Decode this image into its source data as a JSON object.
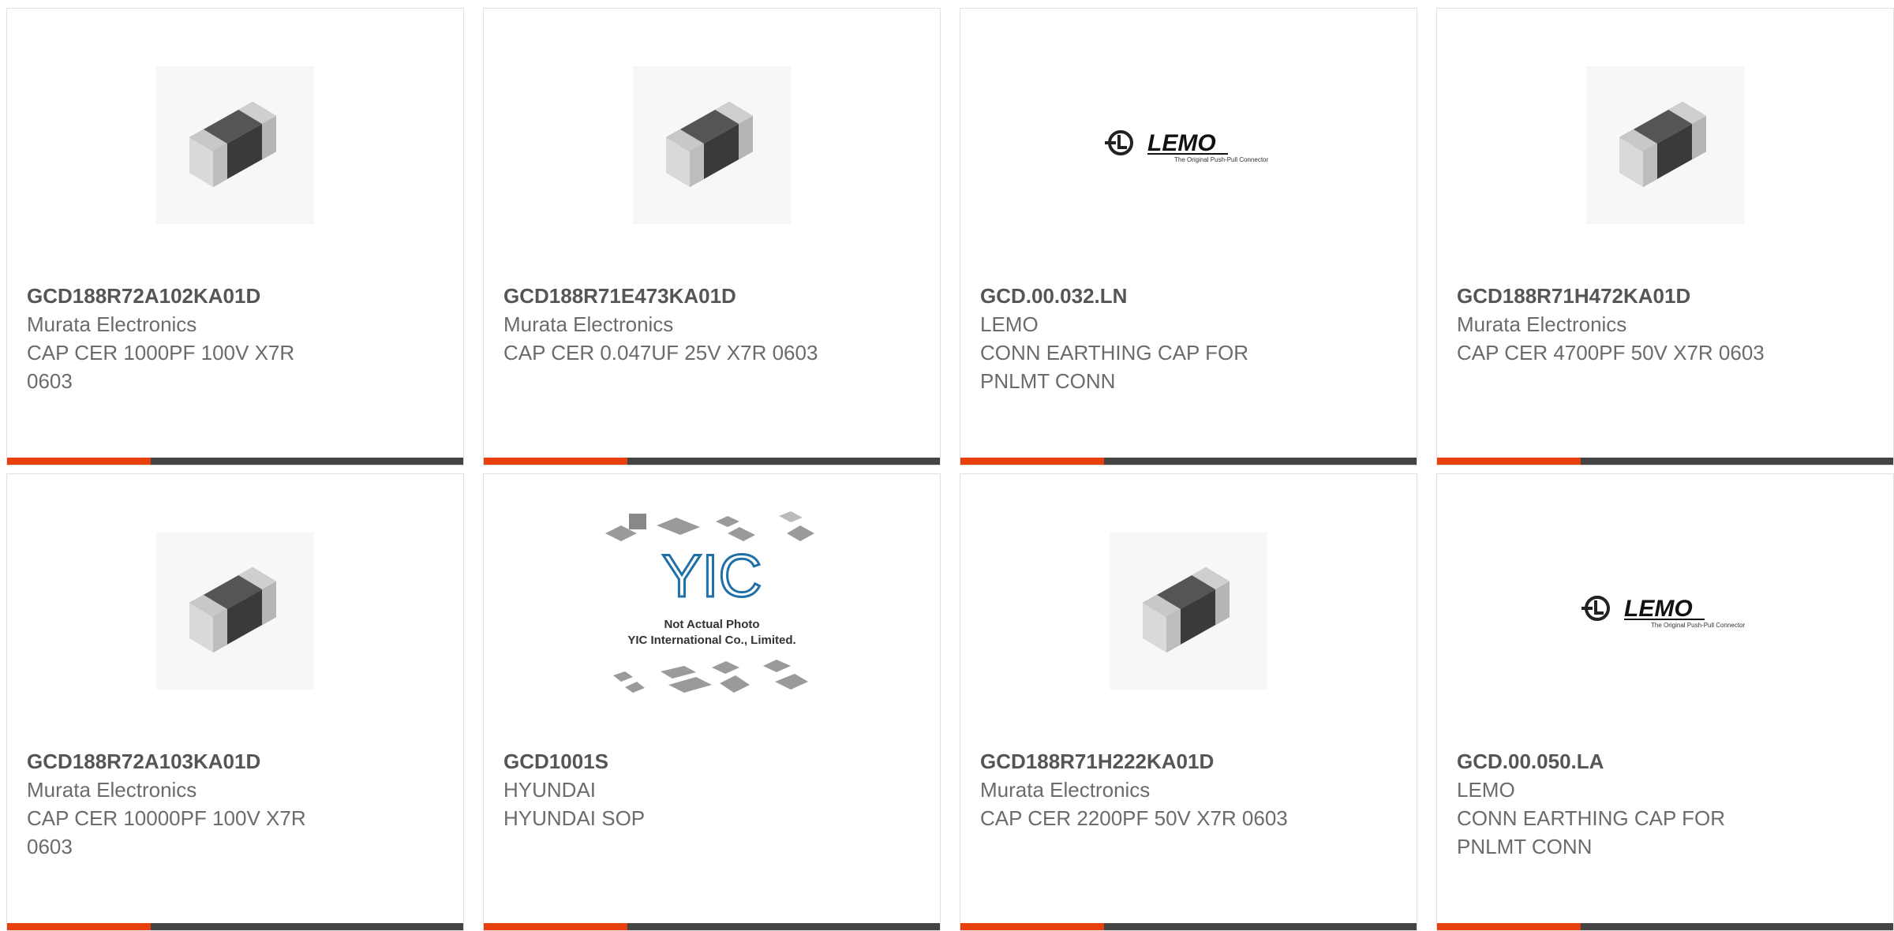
{
  "products": [
    {
      "part_number": "GCD188R72A102KA01D",
      "manufacturer": "Murata Electronics",
      "description": "CAP CER 1000PF 100V X7R 0603",
      "image": "chip-capacitor"
    },
    {
      "part_number": "GCD188R71E473KA01D",
      "manufacturer": "Murata Electronics",
      "description": "CAP CER 0.047UF 25V X7R 0603",
      "image": "chip-capacitor"
    },
    {
      "part_number": "GCD.00.032.LN",
      "manufacturer": "LEMO",
      "description": "CONN EARTHING CAP FOR PNLMT CONN",
      "image": "lemo-logo"
    },
    {
      "part_number": "GCD188R71H472KA01D",
      "manufacturer": "Murata Electronics",
      "description": "CAP CER 4700PF 50V X7R 0603",
      "image": "chip-capacitor"
    },
    {
      "part_number": "GCD188R72A103KA01D",
      "manufacturer": "Murata Electronics",
      "description": "CAP CER 10000PF 100V X7R 0603",
      "image": "chip-capacitor"
    },
    {
      "part_number": "GCD1001S",
      "manufacturer": "HYUNDAI",
      "description": "HYUNDAI SOP",
      "image": "yic-placeholder"
    },
    {
      "part_number": "GCD188R71H222KA01D",
      "manufacturer": "Murata Electronics",
      "description": "CAP CER 2200PF 50V X7R 0603",
      "image": "chip-capacitor"
    },
    {
      "part_number": "GCD.00.050.LA",
      "manufacturer": "LEMO",
      "description": "CONN EARTHING CAP FOR PNLMT CONN",
      "image": "lemo-logo"
    }
  ],
  "logos": {
    "lemo_wordmark": "LEMO",
    "lemo_tagline": "The Original Push-Pull Connector",
    "yic_mark": "YIC",
    "yic_line1": "Not Actual Photo",
    "yic_line2": "YIC International Co., Limited."
  },
  "colors": {
    "accent": "#e8400c",
    "bar": "#444444",
    "text": "#6b6b6b"
  }
}
